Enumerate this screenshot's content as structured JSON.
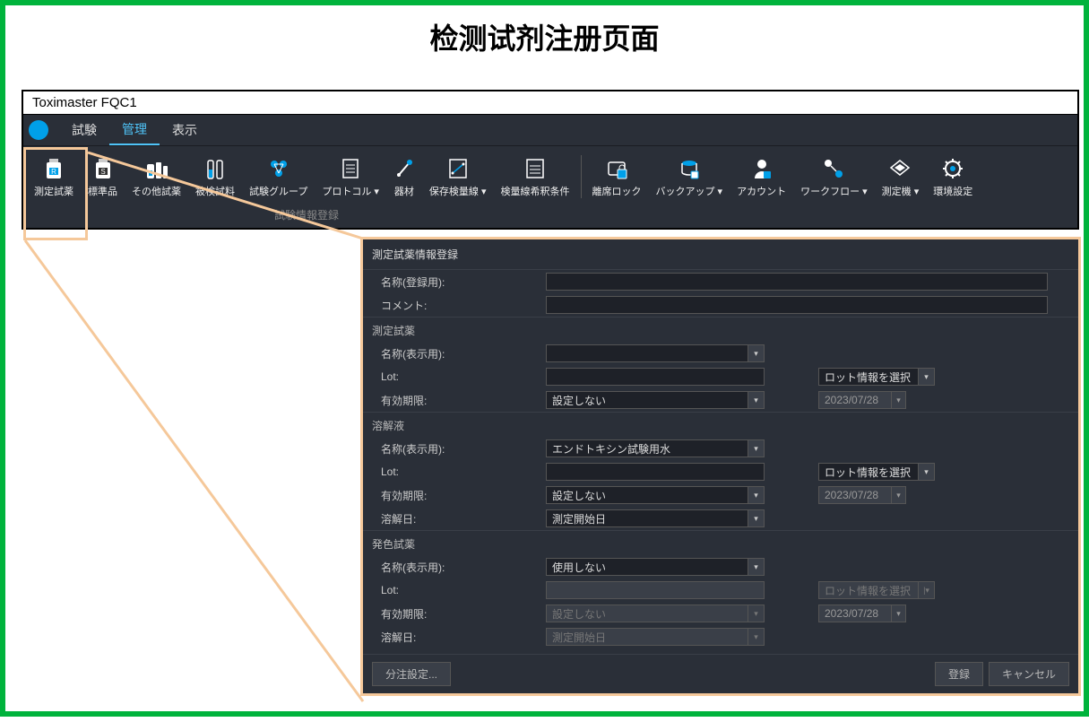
{
  "page_title": "检测试剂注册页面",
  "app_title": "Toximaster FQC1",
  "menu": {
    "test": "試験",
    "manage": "管理",
    "display": "表示"
  },
  "toolbar": [
    {
      "id": "measure-reagent",
      "label": "測定試薬"
    },
    {
      "id": "standards",
      "label": "標準品"
    },
    {
      "id": "other-reagent",
      "label": "その他試薬"
    },
    {
      "id": "test-material",
      "label": "被検試料"
    },
    {
      "id": "test-group",
      "label": "試験グループ"
    },
    {
      "id": "protocol",
      "label": "プロトコル ▾"
    },
    {
      "id": "equipment",
      "label": "器材"
    },
    {
      "id": "stored-calib",
      "label": "保存検量線 ▾"
    },
    {
      "id": "calib-dilution",
      "label": "検量線希釈条件"
    },
    {
      "id": "lock",
      "label": "離席ロック"
    },
    {
      "id": "backup",
      "label": "バックアップ ▾"
    },
    {
      "id": "account",
      "label": "アカウント"
    },
    {
      "id": "workflow",
      "label": "ワークフロー ▾"
    },
    {
      "id": "instrument",
      "label": "測定機 ▾"
    },
    {
      "id": "env",
      "label": "環境設定"
    }
  ],
  "breadcrumb": "試験情報登録",
  "dialog": {
    "title": "測定試薬情報登録",
    "name_reg_label": "名称(登録用):",
    "comment_label": "コメント:",
    "sec_reagent": "測定試薬",
    "sec_solvent": "溶解液",
    "sec_color": "発色試薬",
    "name_disp_label": "名称(表示用):",
    "lot_label": "Lot:",
    "exp_label": "有効期限:",
    "dissolve_label": "溶解日:",
    "lot_select": "ロット情報を選択",
    "exp_val_none": "設定しない",
    "date_val": "2023/07/28",
    "solvent_name": "エンドトキシン試験用水",
    "dissolve_val": "測定開始日",
    "color_name": "使用しない",
    "btn_dispense": "分注設定...",
    "btn_register": "登録",
    "btn_cancel": "キャンセル"
  }
}
